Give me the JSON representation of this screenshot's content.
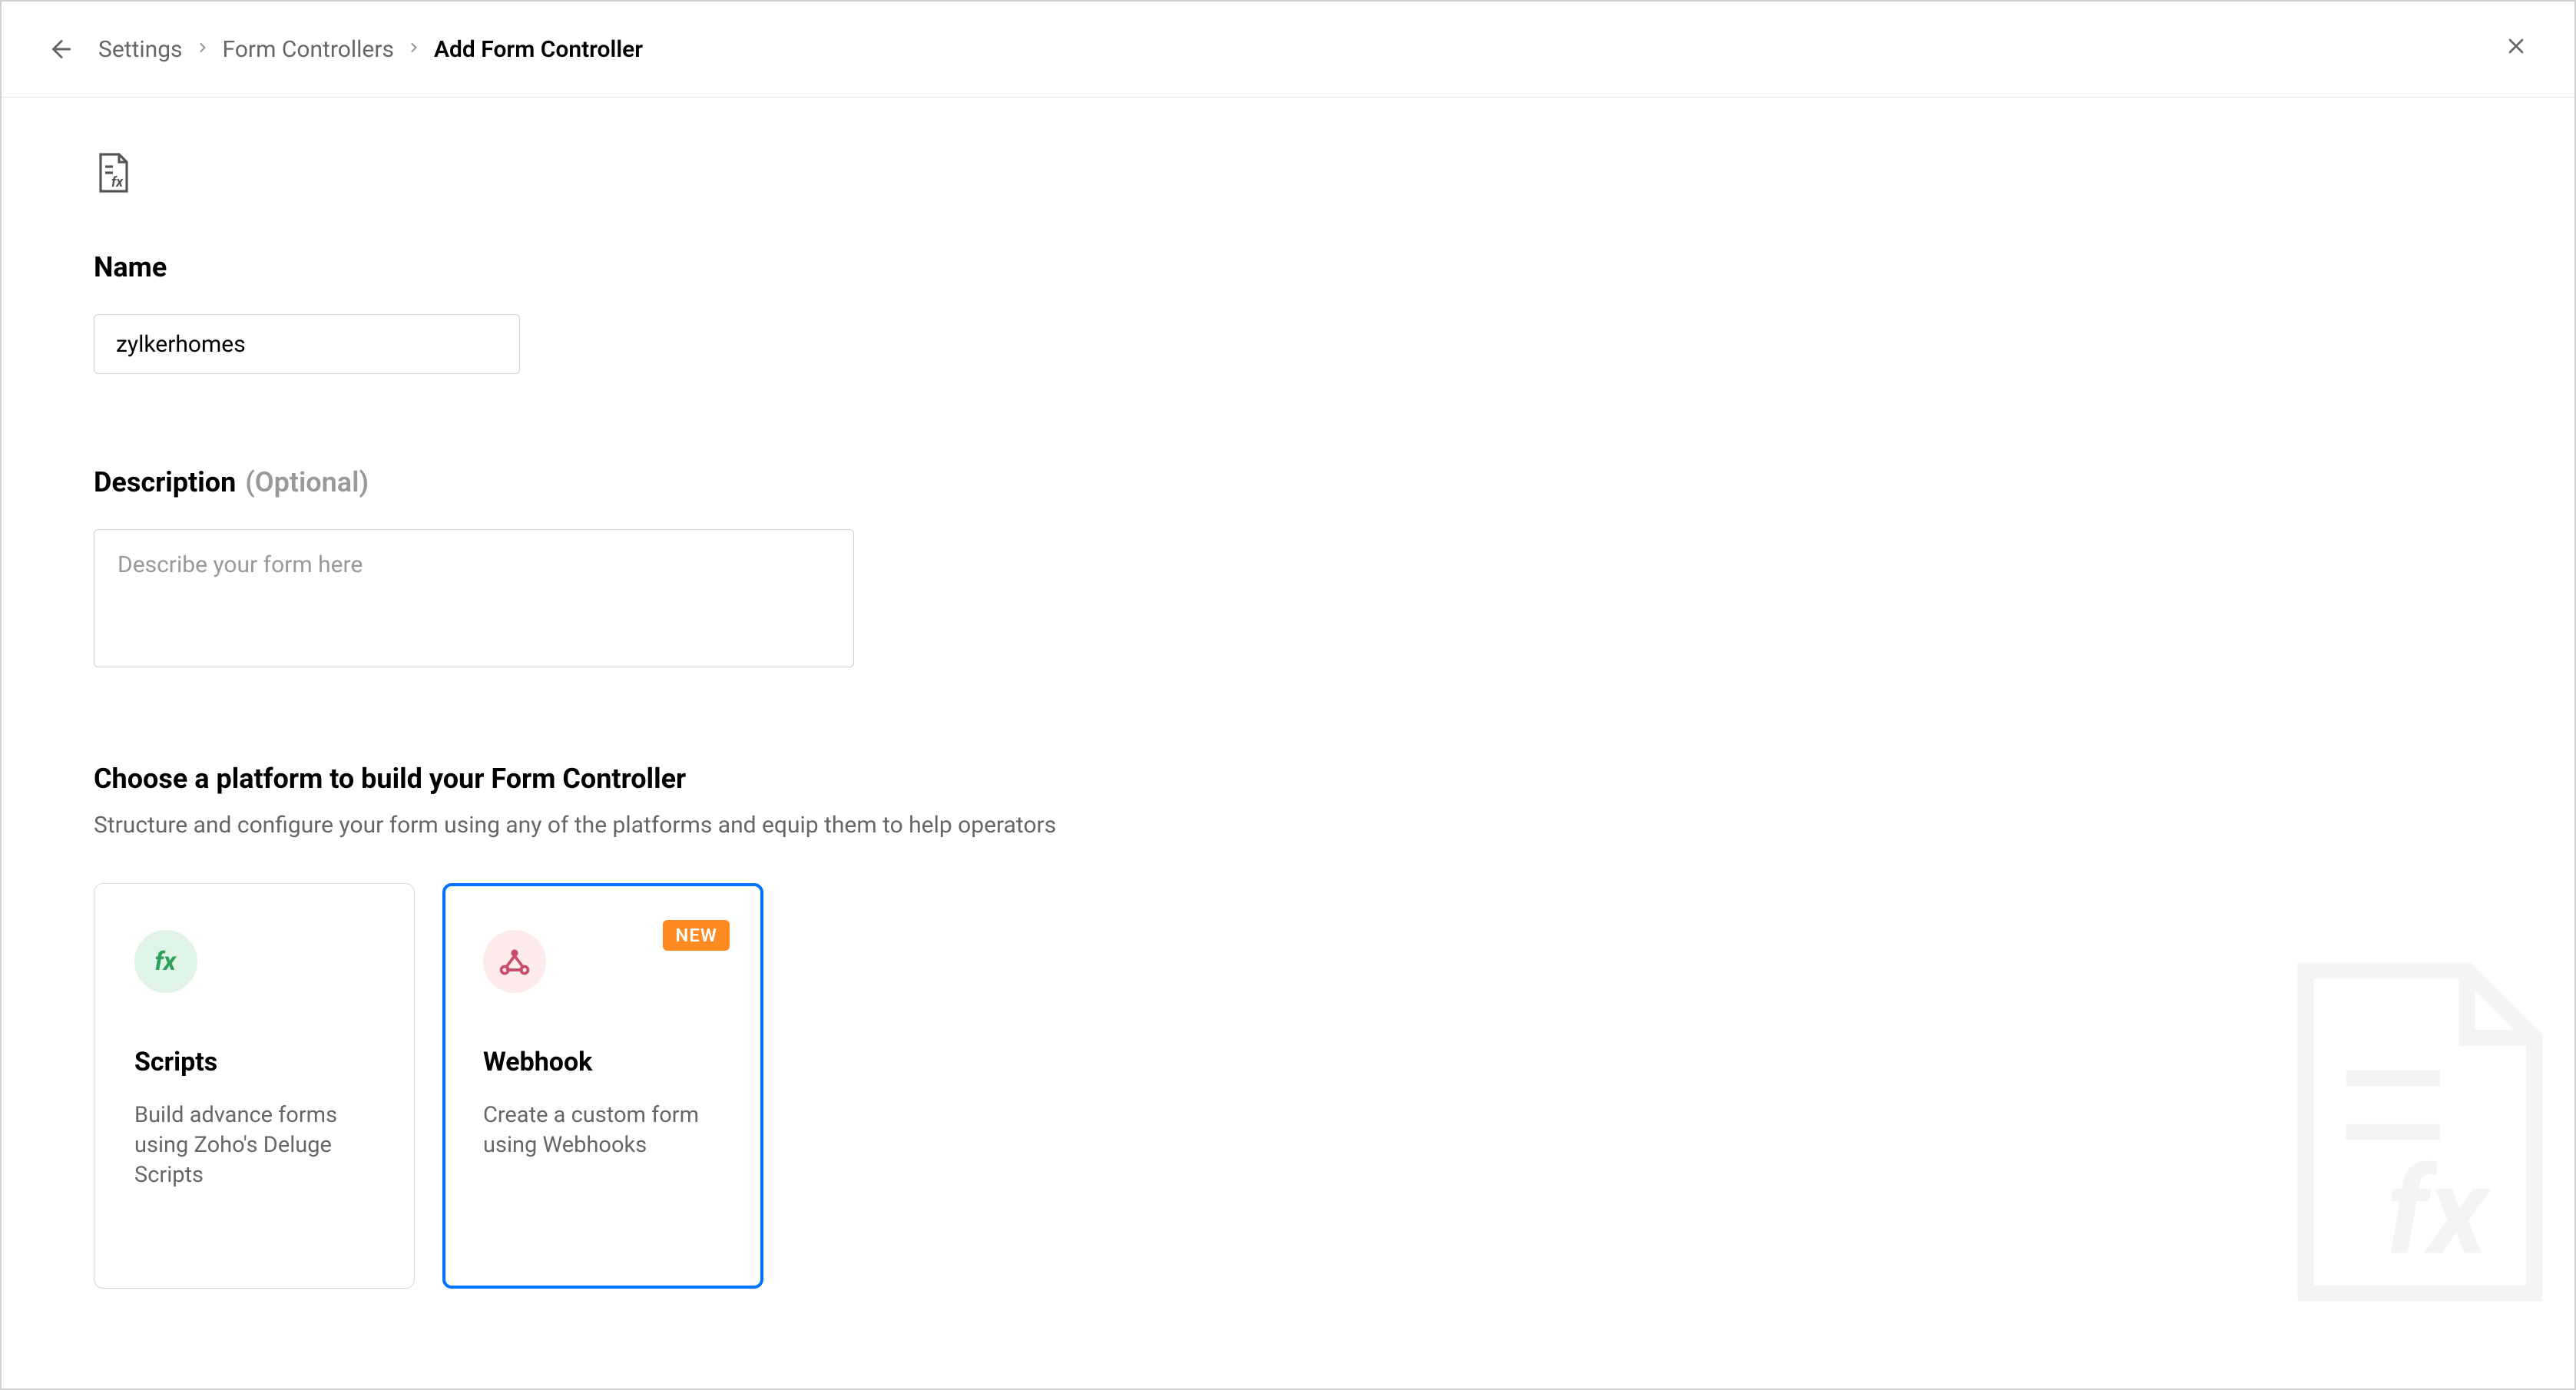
{
  "breadcrumb": {
    "settings": "Settings",
    "form_controllers": "Form Controllers",
    "current": "Add Form Controller"
  },
  "name_field": {
    "label": "Name",
    "value": "zylkerhomes"
  },
  "description_field": {
    "label": "Description",
    "hint": "(Optional)",
    "placeholder": "Describe your form here",
    "value": ""
  },
  "platform_section": {
    "title": "Choose a platform to build your Form Controller",
    "subtitle": "Structure and configure your form using any of the platforms and equip them to help operators"
  },
  "cards": {
    "scripts": {
      "title": "Scripts",
      "description": "Build advance forms using Zoho's Deluge Scripts"
    },
    "webhook": {
      "title": "Webhook",
      "description": "Create a custom form using Webhooks",
      "badge": "NEW"
    }
  }
}
